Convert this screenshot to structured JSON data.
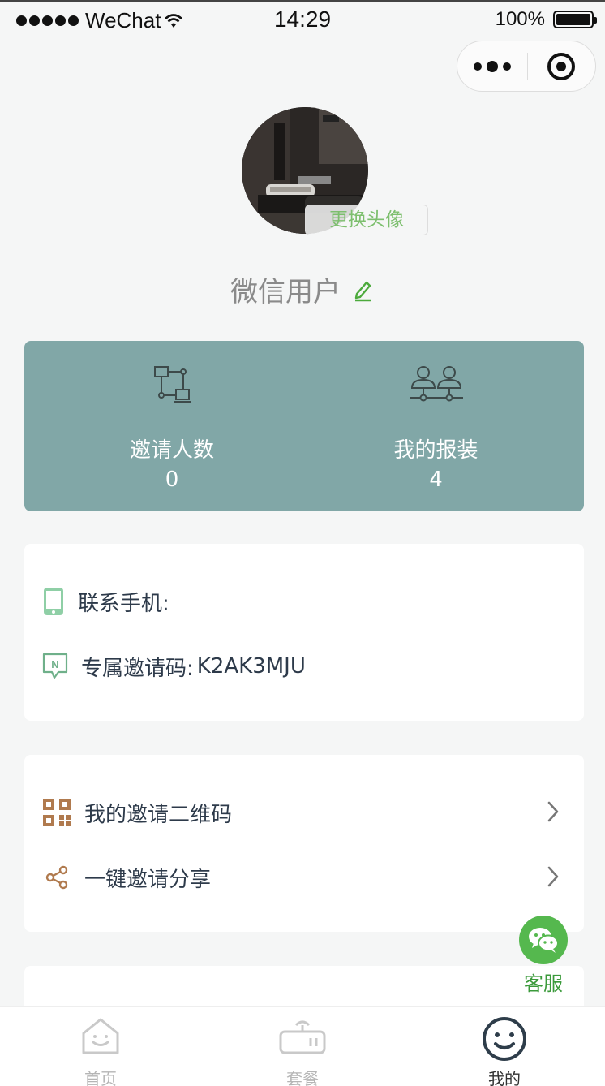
{
  "status_bar": {
    "carrier": "WeChat",
    "time": "14:29",
    "battery": "100%"
  },
  "profile": {
    "change_avatar_label": "更换头像",
    "username": "微信用户"
  },
  "stats": {
    "invites": {
      "label": "邀请人数",
      "value": "0"
    },
    "my_installs": {
      "label": "我的报装",
      "value": "4"
    }
  },
  "info": {
    "phone_label": "联系手机:",
    "invite_code_label": "专属邀请码:",
    "invite_code": "K2AK3MJU"
  },
  "menu": {
    "qr_code": "我的邀请二维码",
    "share": "一键邀请分享"
  },
  "customer_service": {
    "label": "客服"
  },
  "tabbar": {
    "home": "首页",
    "plans": "套餐",
    "mine": "我的"
  },
  "colors": {
    "stats_bg": "#81a7a7",
    "accent_green": "#55b84e",
    "icon_brown": "#b07a4e"
  }
}
